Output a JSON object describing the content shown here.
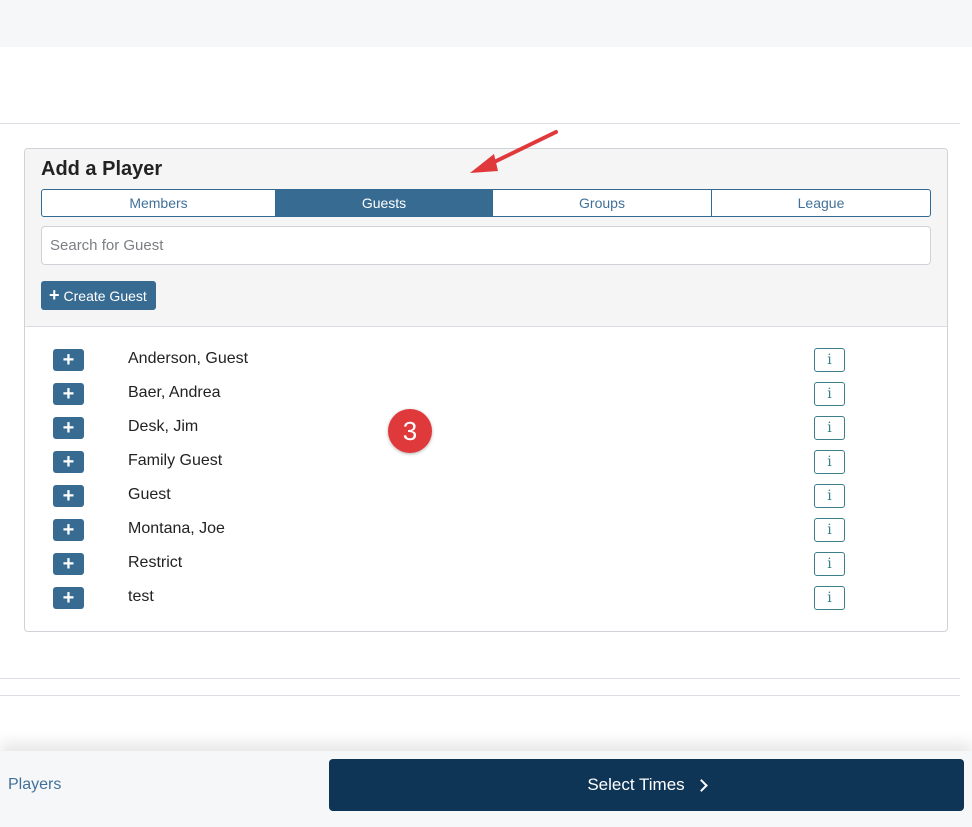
{
  "card": {
    "title": "Add a Player",
    "tabs": [
      {
        "label": "Members",
        "active": false
      },
      {
        "label": "Guests",
        "active": true
      },
      {
        "label": "Groups",
        "active": false
      },
      {
        "label": "League",
        "active": false
      }
    ],
    "search_placeholder": "Search for Guest",
    "create_guest_label": "Create Guest",
    "guests": [
      {
        "name": "Anderson, Guest",
        "info": "i"
      },
      {
        "name": "Baer, Andrea",
        "info": "i"
      },
      {
        "name": "Desk, Jim",
        "info": "i"
      },
      {
        "name": "Family Guest",
        "info": "i"
      },
      {
        "name": "Guest",
        "info": "i"
      },
      {
        "name": "Montana, Joe",
        "info": "i"
      },
      {
        "name": "Restrict",
        "info": "i"
      },
      {
        "name": "test",
        "info": "i"
      }
    ]
  },
  "annotation": {
    "step_number": "3",
    "color": "#e0393b"
  },
  "footer": {
    "players_label": "Players",
    "select_times_label": "Select Times"
  },
  "colors": {
    "accent": "#376b92",
    "primary_button": "#0f3556",
    "info": "#3c7f8c"
  }
}
